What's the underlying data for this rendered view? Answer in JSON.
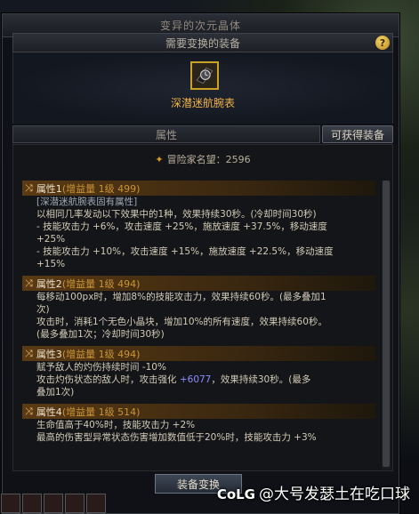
{
  "window": {
    "title": "变异的次元晶体"
  },
  "header": {
    "section_title": "需要变换的装备",
    "help_icon": "?"
  },
  "equipment": {
    "name": "深潜迷航腕表",
    "icon": "watch-icon"
  },
  "tabs": {
    "attributes": "属性",
    "obtain_button": "可获得装备"
  },
  "fame": {
    "label": "冒险家名望：2596"
  },
  "attributes": [
    {
      "name": "属性1",
      "sub": "(增益量 1级 499)",
      "lines": [
        "[深潜迷航腕表固有属性]",
        "以相同几率发动以下效果中的1种，效果持续30秒。(冷却时间30秒)",
        "- 技能攻击力 +6%，攻击速度 +25%，施放速度 +37.5%，移动速度",
        "+25%",
        "- 技能攻击力 +10%，攻击速度 +15%，施放速度 +22.5%，移动速度",
        "+15%"
      ]
    },
    {
      "name": "属性2",
      "sub": "(增益量 1级 494)",
      "lines": [
        "每移动100px时，增加8%的技能攻击力，效果持续60秒。(最多叠加1",
        "次)",
        "攻击时，消耗1个无色小晶块，增加10%的所有速度，效果持续60秒。",
        "(最多叠加1次；冷却时间30秒)"
      ]
    },
    {
      "name": "属性3",
      "sub": "(增益量 1级 494)",
      "lines": [
        "赋予敌人的灼伤持续时间 -10%",
        "攻击灼伤状态的敌人时，攻击强化 +6077，效果持续30秒。(最多",
        "叠加1次)"
      ]
    },
    {
      "name": "属性4",
      "sub": "(增益量 1级 514)",
      "lines": [
        "生命值高于40%时，技能攻击力 +2%",
        "最高的伤害型异常状态伤害增加数值低于20%时，技能攻击力 +3%"
      ]
    }
  ],
  "footer": {
    "bottom_button": "装备变换"
  },
  "watermark": {
    "logo": "CoLG",
    "text": "@大号发瑟土在吃口球"
  },
  "colors": {
    "equipment_name": "#f0b24a",
    "attr_header": "#5a3a14",
    "blue_value": "#8c8cff"
  }
}
